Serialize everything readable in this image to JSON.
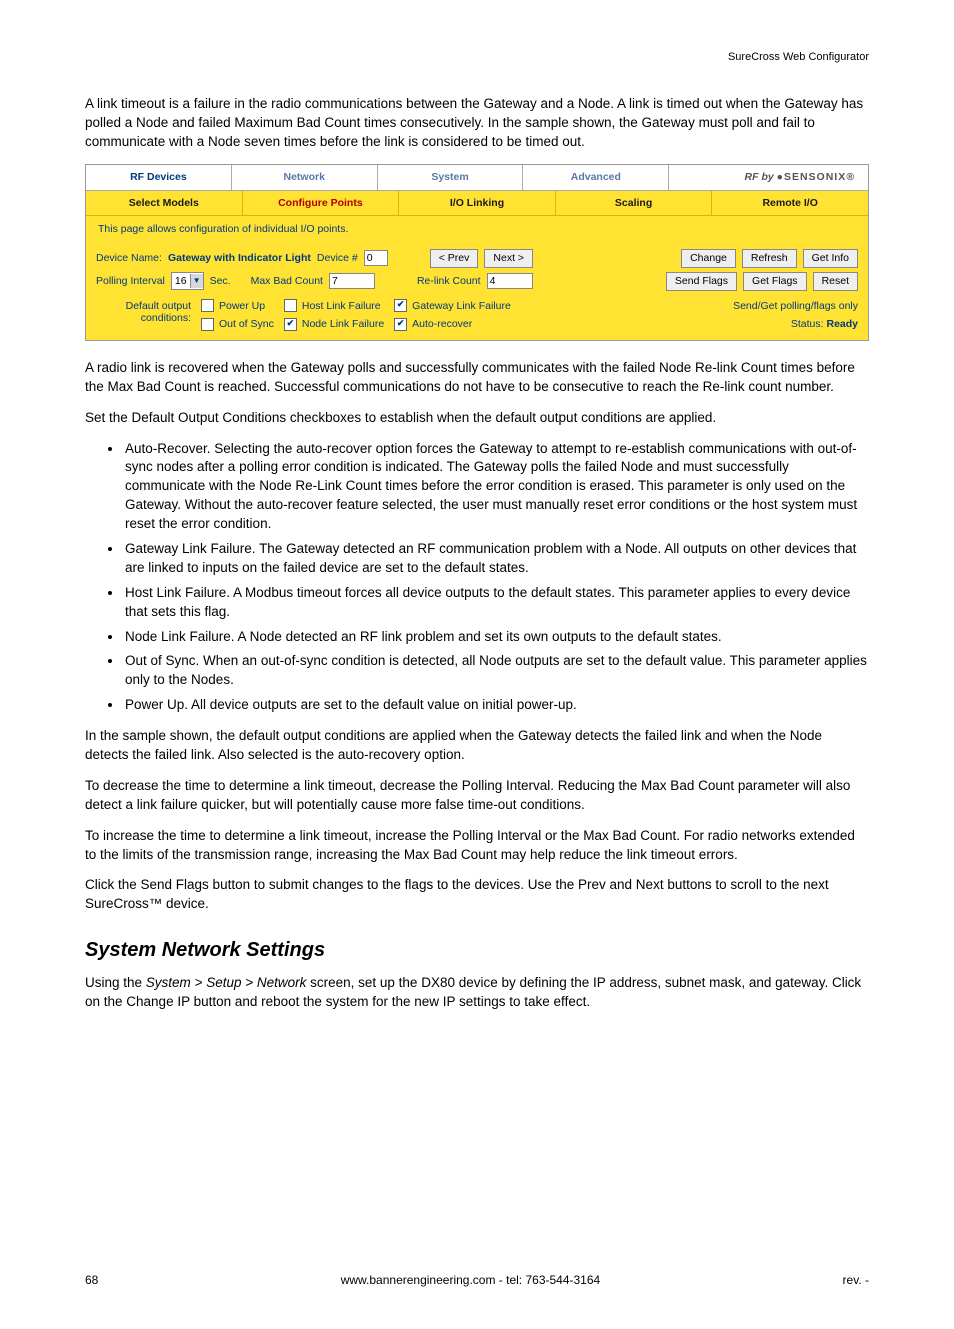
{
  "header": {
    "product": "SureCross Web Configurator"
  },
  "intro_para": "A link timeout is a failure in the radio communications between the Gateway and a Node. A link is timed out when the Gateway has polled a Node and failed Maximum Bad Count times consecutively. In the sample shown, the Gateway must poll and fail to communicate with a Node seven times before the link is considered to be timed out.",
  "ui": {
    "tabs1": {
      "rf": "RF Devices",
      "network": "Network",
      "system": "System",
      "advanced": "Advanced",
      "brand_prefix": "RF by ",
      "brand": "●SENSONIX"
    },
    "tabs2": {
      "select": "Select Models",
      "configure": "Configure Points",
      "io": "I/O Linking",
      "scaling": "Scaling",
      "remote": "Remote I/O"
    },
    "info": "This page allows configuration of individual I/O points.",
    "row1": {
      "dn_label": "Device Name:",
      "dn_value": "Gateway with Indicator Light",
      "devno_label": "Device #",
      "devno_value": "0",
      "prev": "< Prev",
      "next": "Next >",
      "change": "Change",
      "refresh": "Refresh",
      "getinfo": "Get Info"
    },
    "row2": {
      "pi_label": "Polling Interval",
      "pi_value": "16",
      "pi_unit": "Sec.",
      "mbc_label": "Max Bad Count",
      "mbc_value": "7",
      "rlc_label": "Re-link Count",
      "rlc_value": "4",
      "sendflags": "Send Flags",
      "getflags": "Get Flags",
      "reset": "Reset"
    },
    "cond": {
      "label1": "Default output",
      "label2": "conditions:",
      "powerup": "Power Up",
      "oos": "Out of Sync",
      "hlf": "Host Link Failure",
      "nlf": "Node Link Failure",
      "glf": "Gateway Link Failure",
      "ar": "Auto-recover",
      "sg": "Send/Get polling/flags only",
      "status_label": "Status:",
      "status_value": "Ready"
    }
  },
  "para_recover": "A radio link is recovered when the Gateway polls and successfully communicates with the failed Node Re-link Count times before the Max Bad Count is reached. Successful communications do not have to be consecutive to reach the Re-link count number.",
  "para_set": "Set the Default Output Conditions checkboxes to establish when the default output conditions are applied.",
  "bullets": {
    "b1": "Auto-Recover. Selecting the auto-recover option forces the Gateway to attempt to re-establish communications with out-of-sync nodes after a polling error condition is indicated. The Gateway polls the failed Node and must successfully communicate with the Node Re-Link Count times before the error condition is erased. This parameter is only used on the Gateway. Without the auto-recover feature selected, the user must manually reset error conditions or the host system must reset the error condition.",
    "b2": "Gateway Link Failure. The Gateway detected an RF communication problem with a Node. All outputs on other devices that are linked to inputs on the failed device are set to the default states.",
    "b3": "Host Link Failure. A Modbus timeout forces all device outputs to the default states. This parameter applies to every device that sets this flag.",
    "b4": "Node Link Failure. A Node detected an RF link problem and set its own outputs to the default states.",
    "b5": "Out of Sync. When an out-of-sync condition is detected, all Node outputs are set to the default value. This parameter applies only to the Nodes.",
    "b6": "Power Up. All device outputs are set to the default value on initial power-up."
  },
  "para_sample": "In the sample shown, the default output conditions are applied when the Gateway detects the failed link and when the Node detects the failed link. Also selected is the auto-recovery option.",
  "para_decrease": "To decrease the time to determine a link timeout, decrease the Polling Interval. Reducing the Max Bad Count parameter will also detect a link failure quicker, but will potentially cause more false time-out conditions.",
  "para_increase": "To increase the time to determine a link timeout, increase the Polling Interval or the Max Bad Count. For radio networks extended to the limits of the transmission range, increasing the Max Bad Count may help reduce the link timeout errors.",
  "para_click": "Click the Send Flags button to submit changes to the flags to the devices. Use the Prev and Next buttons to scroll to the next SureCross™ device.",
  "section_heading": "System Network Settings",
  "para_network_a": "Using the ",
  "para_network_path": "System > Setup > Network",
  "para_network_b": " screen, set up the DX80 device by defining the IP address, subnet mask, and gateway. Click on the Change IP button and reboot the system for the new IP settings to take effect.",
  "footer": {
    "page": "68",
    "center": "www.bannerengineering.com - tel: 763-544-3164",
    "rev": "rev. -"
  }
}
